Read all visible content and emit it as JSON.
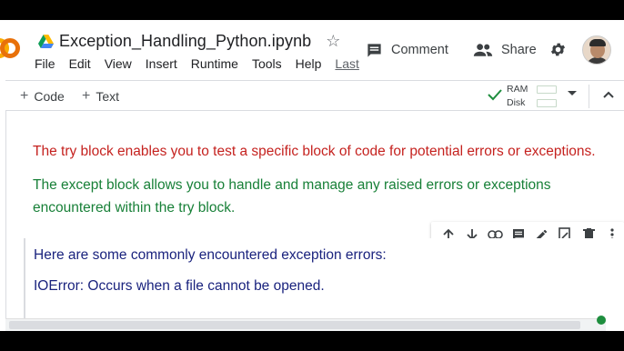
{
  "app": {
    "title": "Exception_Handling_Python.ipynb",
    "menu": [
      "File",
      "Edit",
      "View",
      "Insert",
      "Runtime",
      "Tools",
      "Help"
    ],
    "last_edit_label": "Last"
  },
  "header": {
    "comment_label": "Comment",
    "share_label": "Share"
  },
  "toolbar": {
    "code_label": "Code",
    "text_label": "Text",
    "ram_label": "RAM",
    "disk_label": "Disk"
  },
  "cells": {
    "text_cell": {
      "line_red": "The try block enables you to test a specific block of code for potential errors or exceptions.",
      "line_green": "The except block allows you to handle and manage any raised errors or exceptions encountered within the try block."
    },
    "list_cell": {
      "heading": "Here are some commonly encountered exception errors:",
      "item_1": "IOError: Occurs when a file cannot be opened."
    }
  },
  "colors": {
    "red_text": "#c5221f",
    "green_text": "#188038",
    "navy_text": "#1a237e",
    "status_connected": "#1e8e3e"
  }
}
